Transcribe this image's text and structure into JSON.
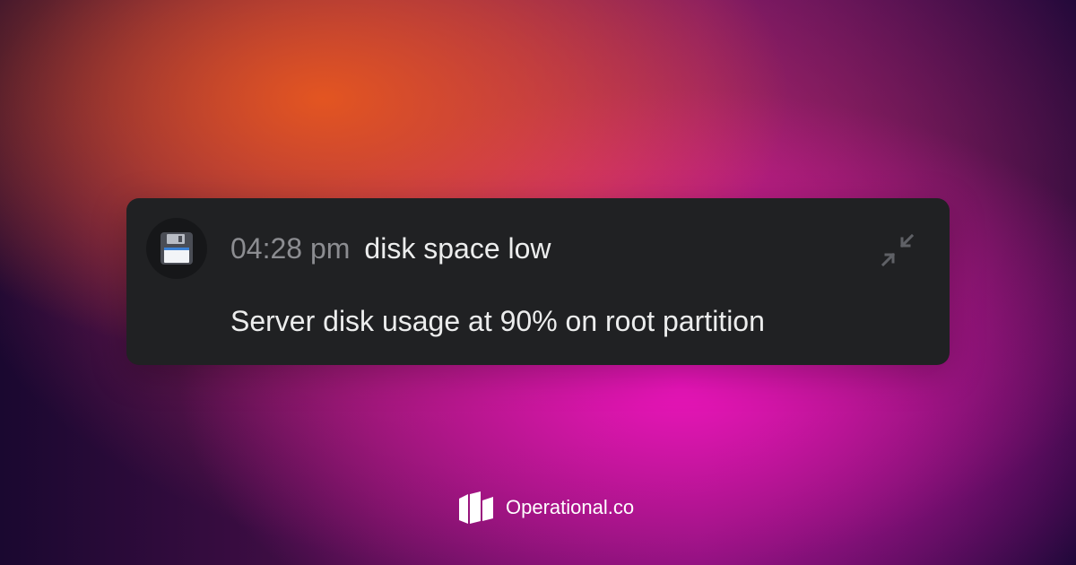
{
  "notification": {
    "time": "04:28 pm",
    "title": "disk space low",
    "message": "Server disk usage at 90% on root partition",
    "icon": "floppy-disk-icon",
    "collapse_icon": "collapse-arrows-icon"
  },
  "brand": {
    "name": "Operational.co",
    "logo": "operational-logo"
  },
  "colors": {
    "card_background": "#202123",
    "time_text": "#8c8d91",
    "primary_text": "#eceded",
    "background_orange": "#e8581e",
    "background_magenta": "#ee14be",
    "background_purple": "#2a0a3a"
  }
}
